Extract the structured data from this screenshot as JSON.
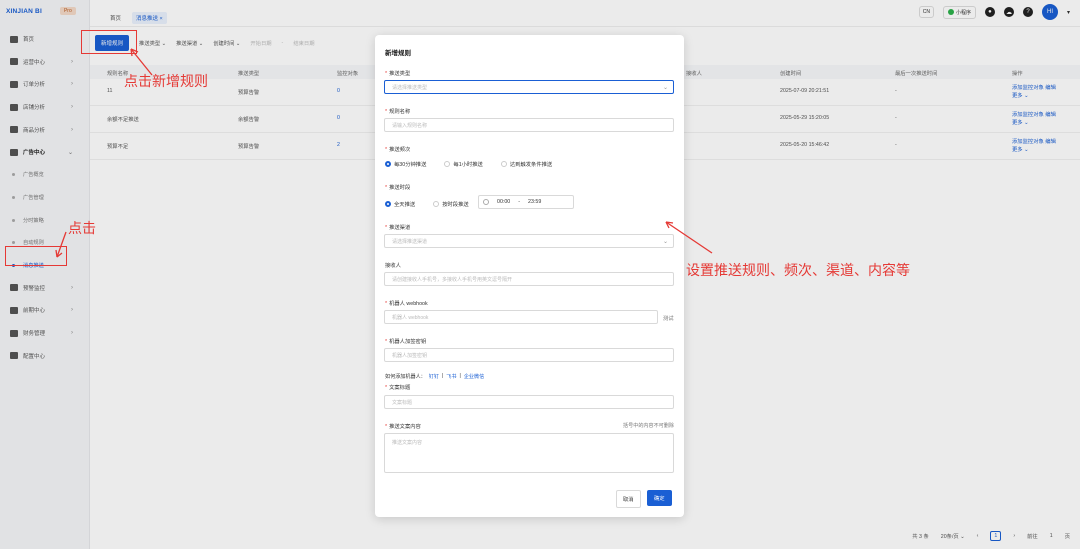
{
  "brand": {
    "name": "XINJIAN BI",
    "badge": "Pro"
  },
  "tabs": [
    "首页",
    "消息推送 ×"
  ],
  "header": {
    "lang": "CN",
    "mini_program": "小程序",
    "avatar": "HI"
  },
  "sidebar": {
    "items": [
      {
        "label": "首页"
      },
      {
        "label": "运营中心"
      },
      {
        "label": "订单分析"
      },
      {
        "label": "店铺分析"
      },
      {
        "label": "商品分析"
      },
      {
        "label": "广告中心"
      },
      {
        "label": "预警监控"
      },
      {
        "label": "前期中心"
      },
      {
        "label": "财务管理"
      },
      {
        "label": "配置中心"
      }
    ],
    "sub_items": [
      {
        "label": "广告概览"
      },
      {
        "label": "广告管理"
      },
      {
        "label": "分时策略"
      },
      {
        "label": "自动规则"
      },
      {
        "label": "消息推送"
      }
    ]
  },
  "toolbar": {
    "add_button": "新增规则",
    "filters": [
      "推送类型 ⌄",
      "推送渠道 ⌄",
      "创建时间 ⌄",
      "开始日期",
      "-",
      "结束日期"
    ]
  },
  "table": {
    "headers": [
      "规则名称",
      "推送类型",
      "监控对象",
      "接收人",
      "创建时间",
      "最后一次推送时间",
      "操作"
    ],
    "rows": [
      {
        "name": "11",
        "type": "预算告警",
        "count": "0",
        "time": "2025-07-09 20:21:51",
        "last": "-",
        "op1": "添加监控对象",
        "op2": "编辑",
        "op3": "更多 ⌄"
      },
      {
        "name": "余额不足推送",
        "type": "余额告警",
        "count": "0",
        "time": "2025-05-29 15:20:05",
        "last": "-",
        "op1": "添加监控对象",
        "op2": "编辑",
        "op3": "更多 ⌄"
      },
      {
        "name": "预算不足",
        "type": "预算告警",
        "count": "2",
        "time": "2025-05-20 15:46:42",
        "last": "-",
        "op1": "添加监控对象",
        "op2": "编辑",
        "op3": "更多 ⌄"
      }
    ]
  },
  "pagination": {
    "total": "共 3 条",
    "size": "20条/页 ⌄",
    "page": "1",
    "goto": "前往",
    "goto_val": "1",
    "page_suffix": "页"
  },
  "modal": {
    "title": "新增规则",
    "push_type_label": "推送类型",
    "push_type_placeholder": "请选择推送类型",
    "rule_name_label": "规则名称",
    "rule_name_placeholder": "请输入规则名称",
    "freq_label": "推送频次",
    "freq_options": [
      "每30分钟推送",
      "每1小时推送",
      "达到触发条件推送"
    ],
    "period_label": "推送时段",
    "period_options": [
      "全天推送",
      "按时段推送"
    ],
    "time_start": "00:00",
    "time_sep": "-",
    "time_end": "23:59",
    "channel_label": "推送渠道",
    "channel_placeholder": "请选择推送渠道",
    "receiver_label": "接收人",
    "receiver_placeholder": "请创建接收人手机号，多接收人手机号用英文逗号隔开",
    "webhook_label": "机器人 webhook",
    "webhook_placeholder": "机器人 webhook",
    "test_label": "测试",
    "secret_label": "机器人加签密钥",
    "secret_placeholder": "机器人加签密钥",
    "howto_prefix": "如何添加机器人：",
    "howto_links": [
      "钉钉",
      "|",
      "飞书",
      "|",
      "企业微信"
    ],
    "copy_title_label": "文案标题",
    "copy_title_placeholder": "文案标题",
    "content_label": "推送文案内容",
    "content_hint": "括号中的内容不可删除",
    "content_placeholder": "推送文案内容",
    "cancel": "取消",
    "ok": "确定"
  },
  "annotations": {
    "add_rule": "点击新增规则",
    "click": "点击",
    "setup": "设置推送规则、频次、渠道、内容等"
  },
  "colors": {
    "primary": "#1a5fd4",
    "annotation": "#e53935"
  }
}
